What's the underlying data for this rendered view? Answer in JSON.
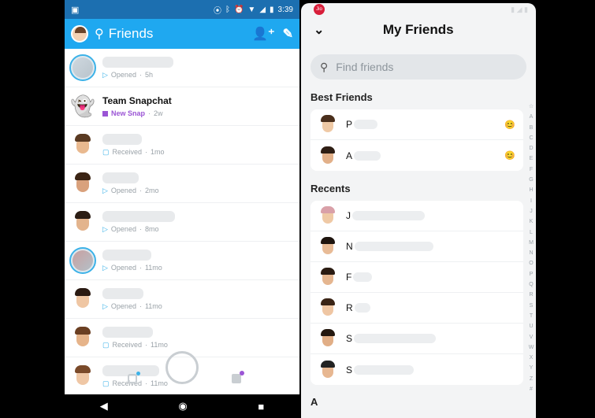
{
  "left": {
    "status": {
      "time": "3:39"
    },
    "header": {
      "title": "Friends",
      "add_friend_icon": "add-friend-icon",
      "new_chat_icon": "new-chat-icon"
    },
    "rows": [
      {
        "name": "",
        "status": "Opened",
        "age": "5h",
        "type": "opened"
      },
      {
        "name": "Team Snapchat",
        "status": "New Snap",
        "age": "2w",
        "type": "new"
      },
      {
        "name": "",
        "status": "Received",
        "age": "1mo",
        "type": "received"
      },
      {
        "name": "",
        "status": "Opened",
        "age": "2mo",
        "type": "opened"
      },
      {
        "name": "",
        "status": "Opened",
        "age": "8mo",
        "type": "opened"
      },
      {
        "name": "",
        "status": "Opened",
        "age": "11mo",
        "type": "opened"
      },
      {
        "name": "",
        "status": "Opened",
        "age": "11mo",
        "type": "opened"
      },
      {
        "name": "",
        "status": "Received",
        "age": "11mo",
        "type": "received"
      },
      {
        "name": "",
        "status": "Received",
        "age": "11mo",
        "type": "received"
      }
    ]
  },
  "right": {
    "status": {
      "carrier": "Jio"
    },
    "title": "My Friends",
    "search": {
      "placeholder": "Find friends"
    },
    "sections": {
      "best": "Best Friends",
      "recents": "Recents",
      "a": "A"
    },
    "best_friends": [
      {
        "name": "P",
        "emoji": "😊"
      },
      {
        "name": "A",
        "emoji": "😊"
      }
    ],
    "recents": [
      {
        "name": "J"
      },
      {
        "name": "N"
      },
      {
        "name": "F"
      },
      {
        "name": "R"
      },
      {
        "name": "S"
      },
      {
        "name": "S"
      }
    ],
    "alphabet": [
      "☆",
      "A",
      "B",
      "C",
      "D",
      "E",
      "F",
      "G",
      "H",
      "I",
      "J",
      "K",
      "L",
      "M",
      "N",
      "O",
      "P",
      "Q",
      "R",
      "S",
      "T",
      "U",
      "V",
      "W",
      "X",
      "Y",
      "Z",
      "#"
    ]
  },
  "colors": {
    "snap_blue": "#1fa8f0",
    "purple": "#9b55d5"
  }
}
